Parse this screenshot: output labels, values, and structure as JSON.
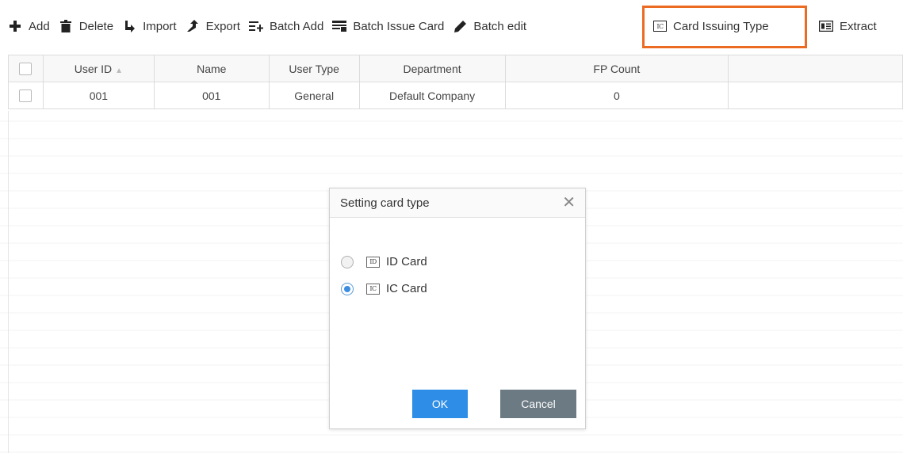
{
  "toolbar": {
    "items": [
      {
        "label": "Add",
        "icon": "plus-icon"
      },
      {
        "label": "Delete",
        "icon": "trash-icon"
      },
      {
        "label": "Import",
        "icon": "import-arrow-icon"
      },
      {
        "label": "Export",
        "icon": "export-arrow-icon"
      },
      {
        "label": "Batch Add",
        "icon": "batch-add-icon"
      },
      {
        "label": "Batch Issue Card",
        "icon": "batch-issue-card-icon"
      },
      {
        "label": "Batch edit",
        "icon": "pencil-icon"
      }
    ],
    "card_issuing_type": {
      "label": "Card Issuing Type",
      "icon": "ic-card-icon",
      "highlight_color": "#ec6b23"
    },
    "extract": {
      "label": "Extract",
      "icon": "extract-card-icon"
    }
  },
  "table": {
    "columns": [
      "User ID",
      "Name",
      "User Type",
      "Department",
      "FP Count"
    ],
    "rows": [
      {
        "user_id": "001",
        "name": "001",
        "user_type": "General",
        "department": "Default Company",
        "fp_count": "0"
      }
    ]
  },
  "dialog": {
    "title": "Setting card type",
    "options": [
      {
        "label": "ID Card",
        "icon_text": "ID",
        "checked": false
      },
      {
        "label": "IC Card",
        "icon_text": "IC",
        "checked": true
      }
    ],
    "ok_label": "OK",
    "cancel_label": "Cancel",
    "ok_color": "#2e8de6",
    "cancel_color": "#6b7a83"
  }
}
